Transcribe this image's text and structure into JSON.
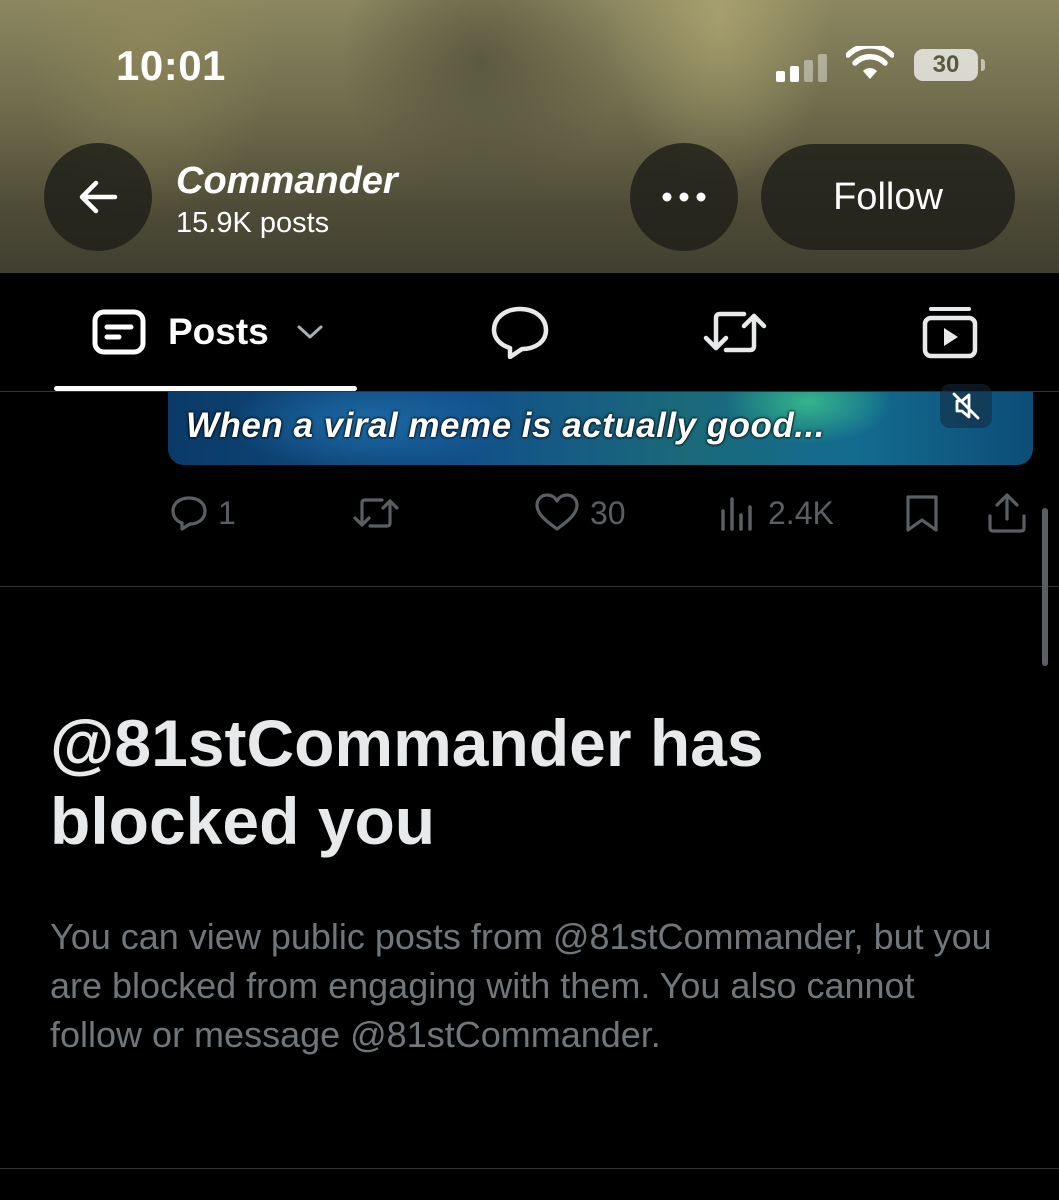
{
  "status_bar": {
    "time": "10:01",
    "battery_level": "30",
    "signal_bars": 2,
    "icons": [
      "signal-icon",
      "wifi-icon",
      "battery-icon"
    ]
  },
  "profile_header": {
    "name": "Commander",
    "post_count": "15.9K posts",
    "follow_label": "Follow",
    "icons": [
      "back-arrow-icon",
      "more-icon"
    ]
  },
  "tabs": {
    "posts_label": "Posts",
    "active": "posts",
    "icons": [
      "posts-icon",
      "chevron-down-icon",
      "replies-icon",
      "reposts-icon",
      "media-icon"
    ]
  },
  "post": {
    "media_caption": "When a viral meme is actually good...",
    "reply_count": "1",
    "like_count": "30",
    "view_count": "2.4K",
    "icons": [
      "mute-icon",
      "reply-icon",
      "repost-icon",
      "like-icon",
      "views-icon",
      "bookmark-icon",
      "share-icon"
    ]
  },
  "blocked": {
    "title": "@81stCommander has blocked you",
    "body": "You can view public posts from @81stCommander, but you are blocked from engaging with them. You also cannot follow or message @81stCommander."
  },
  "colors": {
    "background": "#000000",
    "primary_text": "#e7e9ea",
    "secondary_text": "#71767b",
    "divider": "#2f3336",
    "action_icon": "#5b5f63"
  }
}
